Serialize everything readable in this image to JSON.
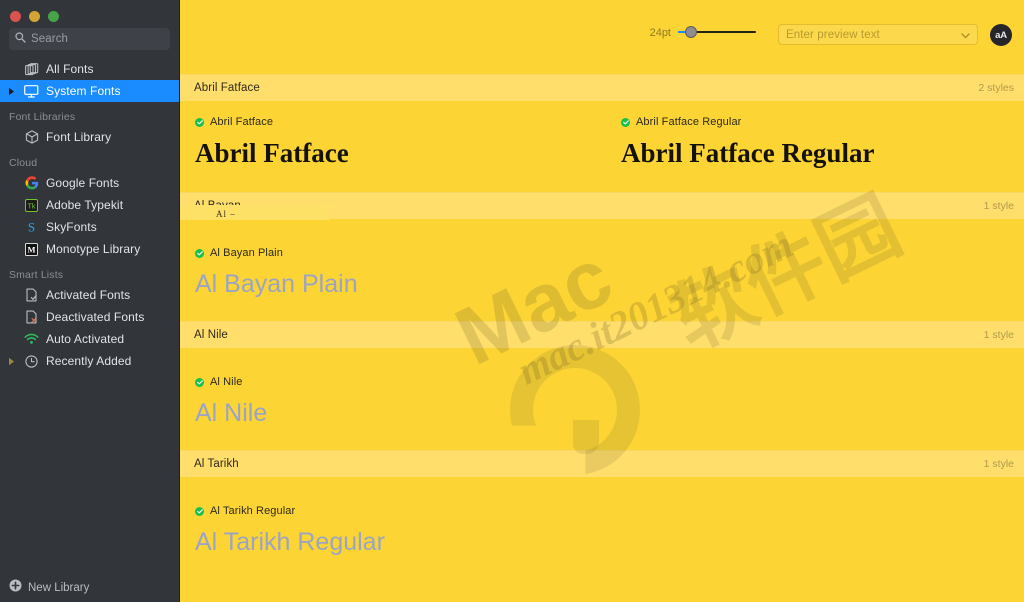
{
  "window": {
    "traffic_lights": [
      "close",
      "minimize",
      "maximize"
    ]
  },
  "sidebar": {
    "search": {
      "placeholder": "Search",
      "value": "",
      "icon": "search-icon"
    },
    "top_items": [
      {
        "label": "All Fonts",
        "icon": "stacked-pages-icon",
        "selected": false,
        "disclosure": false
      },
      {
        "label": "System Fonts",
        "icon": "display-monitor-icon",
        "selected": true,
        "disclosure": true
      }
    ],
    "groups": [
      {
        "title": "Font Libraries",
        "items": [
          {
            "label": "Font Library",
            "icon": "cube-box-icon",
            "selected": false,
            "disclosure": false
          }
        ]
      },
      {
        "title": "Cloud",
        "items": [
          {
            "label": "Google Fonts",
            "icon": "google-g-icon",
            "selected": false,
            "disclosure": false
          },
          {
            "label": "Adobe Typekit",
            "icon": "adobe-typekit-icon",
            "selected": false,
            "disclosure": false
          },
          {
            "label": "SkyFonts",
            "icon": "skyfonts-s-icon",
            "selected": false,
            "disclosure": false
          },
          {
            "label": "Monotype Library",
            "icon": "monotype-m-icon",
            "selected": false,
            "disclosure": false
          }
        ]
      },
      {
        "title": "Smart Lists",
        "items": [
          {
            "label": "Activated Fonts",
            "icon": "document-check-icon",
            "selected": false,
            "disclosure": false
          },
          {
            "label": "Deactivated Fonts",
            "icon": "document-x-icon",
            "selected": false,
            "disclosure": false
          },
          {
            "label": "Auto Activated",
            "icon": "wifi-icon",
            "selected": false,
            "disclosure": false
          },
          {
            "label": "Recently Added",
            "icon": "clock-icon",
            "selected": false,
            "disclosure": true
          }
        ]
      }
    ],
    "footer": {
      "label": "New Library",
      "icon": "plus-circle-icon"
    }
  },
  "toolbar": {
    "size_label": "24pt",
    "slider": {
      "value": 24,
      "min": 10,
      "max": 288,
      "fill_percent": 14
    },
    "preview_input": {
      "placeholder": "Enter preview text",
      "value": ""
    },
    "dropdown_icon": "chevron-down-icon",
    "text_options_button": {
      "label": "aA",
      "icon": "text-size-icon"
    }
  },
  "font_families": [
    {
      "name": "Abril Fatface",
      "style_count": "2 styles",
      "samples": [
        {
          "style_name": "Abril Fatface",
          "preview": "Abril Fatface",
          "status": "activated",
          "render": "serif-black"
        },
        {
          "style_name": "Abril Fatface Regular",
          "preview": "Abril Fatface Regular",
          "status": "activated",
          "render": "serif-black"
        }
      ]
    },
    {
      "name": "Al Bayan",
      "style_count": "1 style",
      "glyph_remnant": "Al –",
      "samples": [
        {
          "style_name": "Al Bayan Plain",
          "preview": "Al Bayan Plain",
          "status": "activated",
          "render": "arabic-latin"
        }
      ]
    },
    {
      "name": "Al Nile",
      "style_count": "1 style",
      "samples": [
        {
          "style_name": "Al Nile",
          "preview": "Al Nile",
          "status": "activated",
          "render": "arabic-latin"
        }
      ]
    },
    {
      "name": "Al Tarikh",
      "style_count": "1 style",
      "samples": [
        {
          "style_name": "Al Tarikh Regular",
          "preview": "Al Tarikh Regular",
          "status": "activated",
          "render": "arabic-latin"
        }
      ]
    }
  ],
  "watermark": {
    "line1": "Mac",
    "line2": "mac.it201314.com",
    "cn": "软件园"
  },
  "colors": {
    "sidebar_bg": "#32353a",
    "selection_blue": "#1a8cff",
    "main_bg": "#fcd434",
    "family_header_bg": "#ffde6b",
    "badge_green": "#18c14a",
    "sample_text_color": "#9ba4c4"
  }
}
